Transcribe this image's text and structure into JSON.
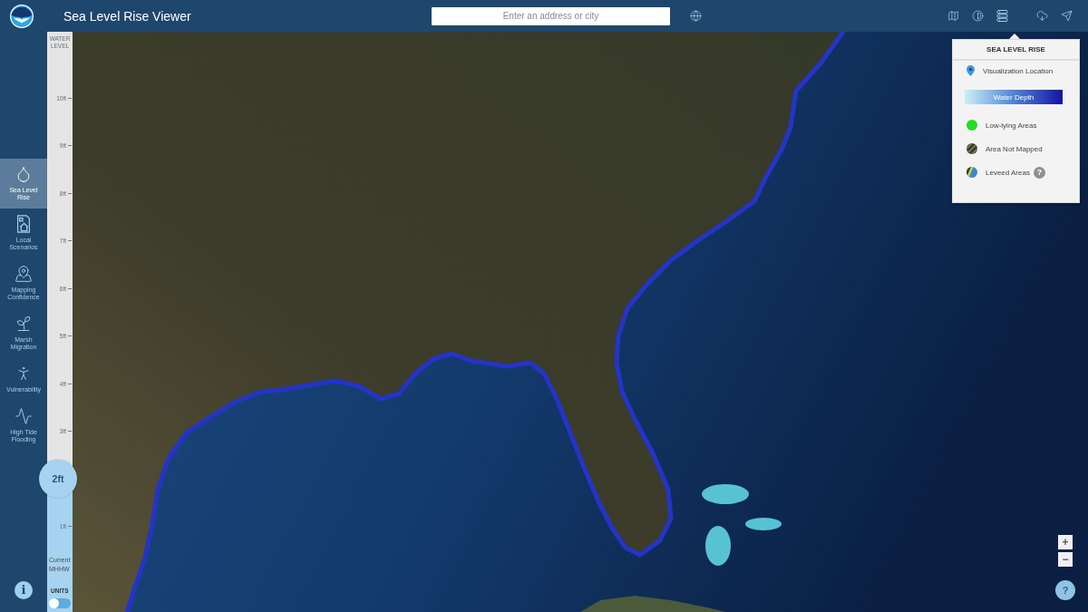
{
  "header": {
    "title": "Sea Level Rise Viewer",
    "search": {
      "placeholder": "Enter an address or city"
    }
  },
  "sidebar": {
    "items": [
      {
        "label": "Sea Level Rise",
        "selected": true
      },
      {
        "label": "Local Scenarios",
        "selected": false
      },
      {
        "label": "Mapping Confidence",
        "selected": false
      },
      {
        "label": "Marsh Migration",
        "selected": false
      },
      {
        "label": "Vulnerability",
        "selected": false
      },
      {
        "label": "High Tide Flooding",
        "selected": false
      }
    ],
    "info": "i"
  },
  "water_level": {
    "title": "WATER LEVEL",
    "ticks": [
      "10ft",
      "9ft",
      "8ft",
      "7ft",
      "6ft",
      "5ft",
      "4ft",
      "3ft",
      "1ft"
    ],
    "value": "2ft",
    "level": 0.2,
    "baseline": "Current MHHW",
    "units": {
      "label": "UNITS",
      "on": false
    }
  },
  "legend": {
    "title": "SEA LEVEL RISE",
    "items": [
      {
        "kind": "location",
        "label": "Visualization Location"
      },
      {
        "kind": "gradient",
        "label": "Water Depth"
      },
      {
        "kind": "dot",
        "label": "Low-lying Areas",
        "color": "#22dd22"
      },
      {
        "kind": "hatched",
        "label": "Area Not Mapped"
      },
      {
        "kind": "levee",
        "label": "Leveed Areas",
        "help": "?"
      }
    ]
  },
  "map_controls": {
    "zoom_in": "+",
    "zoom_out": "−",
    "help": "?"
  }
}
